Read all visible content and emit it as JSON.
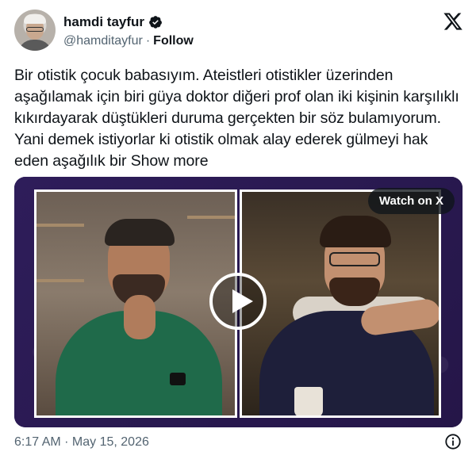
{
  "author": {
    "name": "hamdi tayfur",
    "handle": "@hamditayfur",
    "follow_label": "Follow",
    "separator": "·",
    "verified_icon": "verified-badge-icon"
  },
  "platform": {
    "logo_icon": "x-logo-icon"
  },
  "tweet": {
    "text": "Bir otistik çocuk babasıyım. Ateistleri otistikler üzerinden aşağılamak için biri güya doktor diğeri prof olan iki kişinin karşılıklı kıkırdayarak düştükleri duruma gerçekten bir söz bulamıyorum. Yani demek istiyorlar ki otistik olmak alay ederek gülmeyi hak eden aşağılık bir",
    "show_more": "Show more"
  },
  "media": {
    "watch_label": "Watch on X",
    "play_icon": "play-icon"
  },
  "footer": {
    "timestamp": "6:17 AM · May 15, 2026",
    "info_icon": "info-icon"
  },
  "colors": {
    "text": "#0f1419",
    "secondary": "#536471",
    "verified": "#1d9bf0",
    "media_bg": "#2a1b52"
  }
}
